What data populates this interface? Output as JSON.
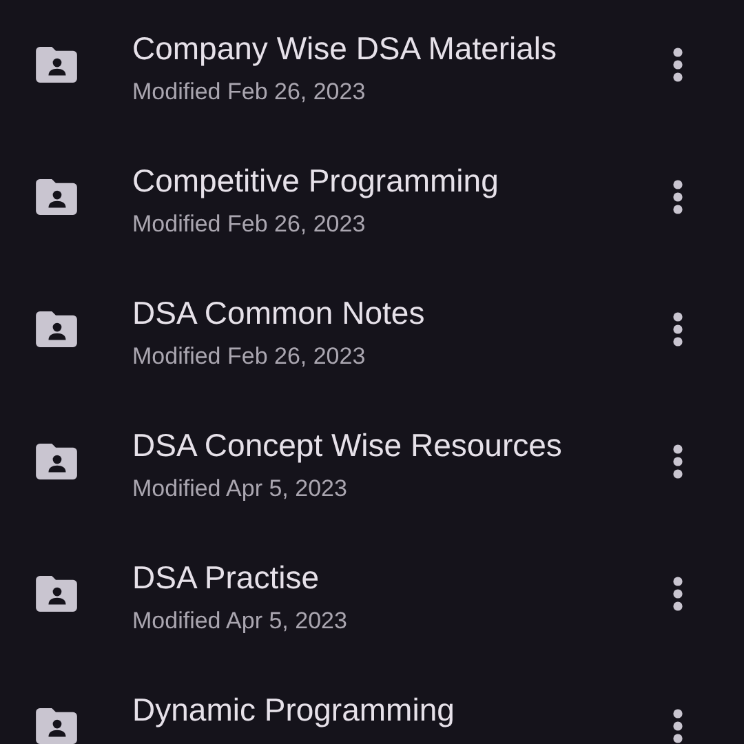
{
  "folders": [
    {
      "name": "Company Wise DSA Materials",
      "modified": "Modified Feb 26, 2023"
    },
    {
      "name": "Competitive Programming",
      "modified": "Modified Feb 26, 2023"
    },
    {
      "name": "DSA Common Notes",
      "modified": "Modified Feb 26, 2023"
    },
    {
      "name": "DSA Concept Wise Resources",
      "modified": "Modified Apr 5, 2023"
    },
    {
      "name": "DSA Practise",
      "modified": "Modified Apr 5, 2023"
    },
    {
      "name": "Dynamic Programming"
    }
  ]
}
